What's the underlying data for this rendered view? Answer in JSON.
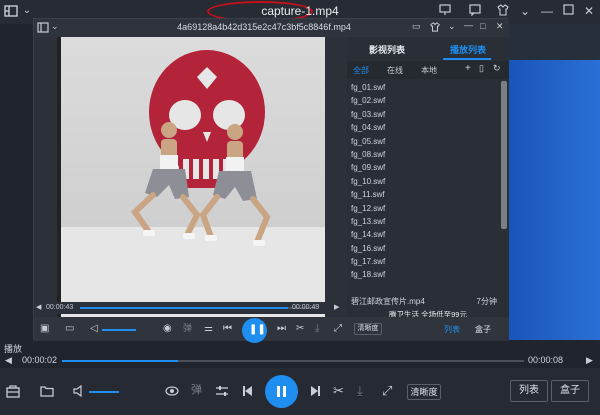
{
  "outer": {
    "title": "capture-1.mp4"
  },
  "inner": {
    "title": "4a69128a4b42d315e2c47c3bf5c8846f.mp4"
  },
  "panel": {
    "tab_video_list": "影视列表",
    "tab_playlist": "播放列表",
    "subtabs": [
      "全部",
      "在线",
      "本地"
    ],
    "items": [
      "fg_01.swf",
      "fg_02.swf",
      "fg_03.swf",
      "fg_04.swf",
      "fg_05.swf",
      "fg_08.swf",
      "fg_09.swf",
      "fg_10.swf",
      "fg_11.swf",
      "fg_12.swf",
      "fg_13.swf",
      "fg_14.swf",
      "fg_16.swf",
      "fg_17.swf",
      "fg_18.swf"
    ],
    "featured_name": "碧江邮政宣传片.mp4",
    "featured_duration": "7分钟",
    "ad_text": "腾卫生活 全场低至99元"
  },
  "inner_player": {
    "time_current": "00:00:43",
    "time_total": "00:00:49",
    "quality_label": "清晰度",
    "list_label": "列表",
    "box_label": "盒子",
    "progress": 0.88
  },
  "bottom": {
    "label": "播放",
    "time_current": "00:00:02",
    "time_total": "00:00:08",
    "quality_label": "清晰度",
    "list_label": "列表",
    "box_label": "盒子",
    "progress": 0.25
  },
  "colors": {
    "accent": "#1e8ff0",
    "annotation_red": "#c8101a",
    "blue_panel": "#1a55b8"
  }
}
